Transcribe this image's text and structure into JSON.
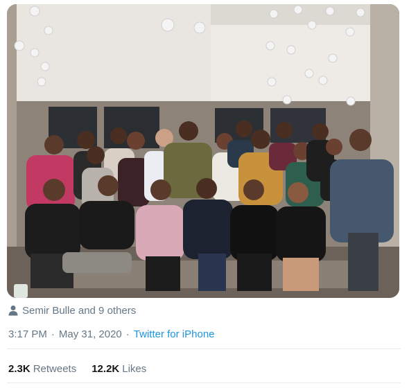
{
  "tweet": {
    "tagged_text": "Semir Bulle and 9 others",
    "time": "3:17 PM",
    "separator": "·",
    "date": "May 31, 2020",
    "source": "Twitter for iPhone",
    "retweets_count": "2.3K",
    "retweets_label": "Retweets",
    "likes_count": "12.2K",
    "likes_label": "Likes"
  },
  "colors": {
    "link": "#1b95e0",
    "secondary_text": "#657786",
    "divider": "#e6ecf0"
  },
  "icons": {
    "tagged": "person-icon"
  }
}
